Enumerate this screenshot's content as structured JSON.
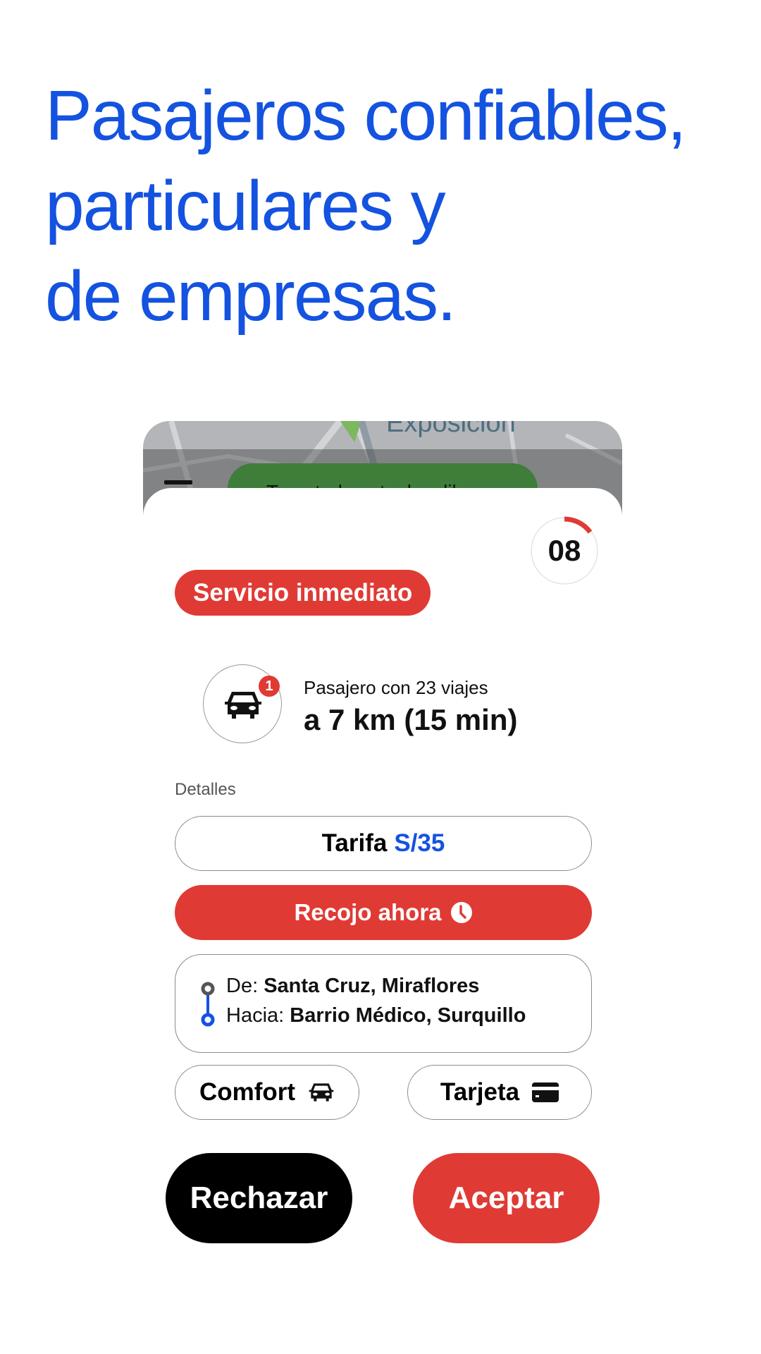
{
  "headline": {
    "lines": [
      "Pasajeros confiables,",
      "particulares y",
      "de empresas."
    ],
    "color": "#1452e0"
  },
  "map": {
    "label": "Exposición",
    "banner_text": "Tu estado actual es libre"
  },
  "request": {
    "timer": {
      "value": "08",
      "remaining_fraction": 0.15
    },
    "service_badge": "Servicio inmediato",
    "passenger": {
      "notification_count": "1",
      "trips_text": "Pasajero con 23 viajes",
      "distance_text": "a 7 km (15 min)"
    },
    "details_label": "Detalles",
    "fare": {
      "label": "Tarifa",
      "value": "S/35"
    },
    "pickup": {
      "label": "Recojo ahora",
      "icon": "clock-icon"
    },
    "route": {
      "from_prefix": "De:",
      "from_value": "Santa Cruz, Miraflores",
      "to_prefix": "Hacia:",
      "to_value": "Barrio Médico, Surquillo"
    },
    "chips": [
      {
        "label": "Comfort",
        "icon": "car-icon"
      },
      {
        "label": "Tarjeta",
        "icon": "credit-card-icon"
      }
    ],
    "actions": {
      "reject": "Rechazar",
      "accept": "Aceptar"
    }
  },
  "colors": {
    "primary_blue": "#1452e0",
    "accent_red": "#e03a35",
    "black": "#000000"
  }
}
